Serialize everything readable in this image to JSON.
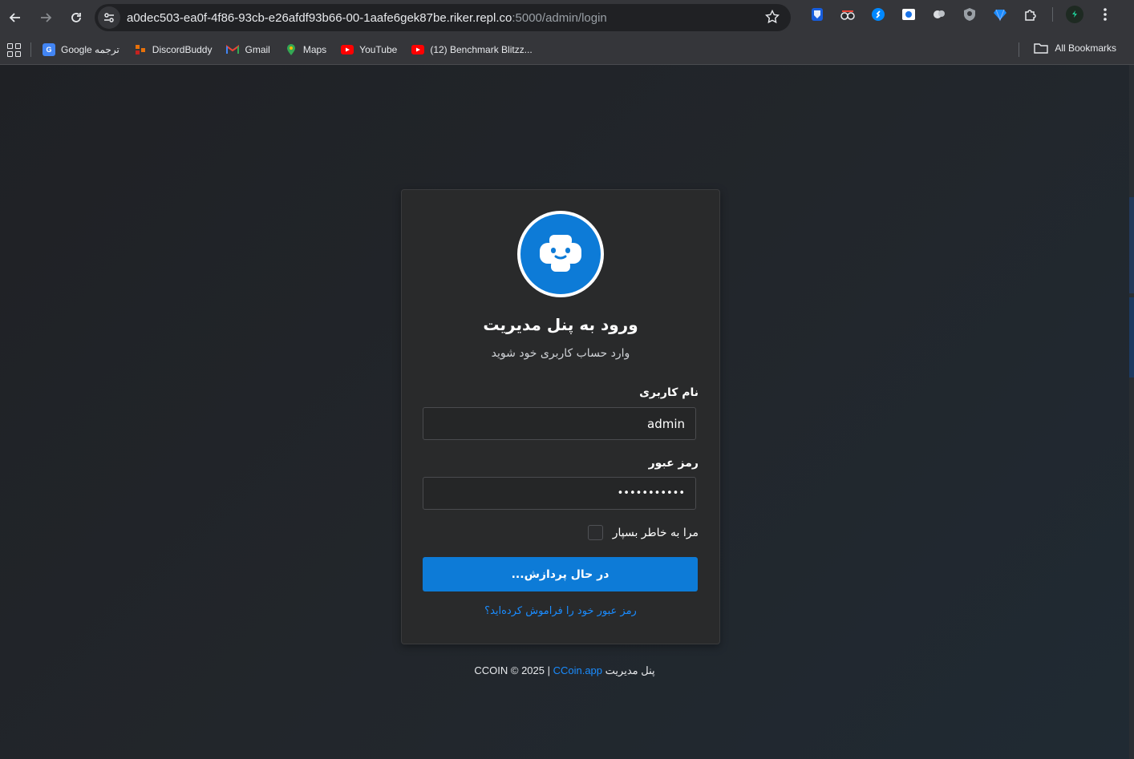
{
  "browser": {
    "url_host": "a0dec503-ea0f-4f86-93cb-e26afdf93b66-00-1aafe6gek87be.riker.repl.co",
    "url_path": ":5000/admin/login",
    "icons": {
      "back": "arrow-left-icon",
      "forward": "arrow-right-icon",
      "reload": "reload-icon",
      "site_settings": "tune-icon",
      "bookmark_star": "star-icon",
      "extensions": "puzzle-icon",
      "menu": "kebab-menu-icon"
    },
    "bookmarks": [
      {
        "label": "Google ترجمه",
        "icon": "google-translate-icon",
        "color": "#4285f4"
      },
      {
        "label": "DiscordBuddy",
        "icon": "discordbuddy-icon",
        "color": "#e8710a"
      },
      {
        "label": "Gmail",
        "icon": "gmail-icon",
        "color": "#ea4335"
      },
      {
        "label": "Maps",
        "icon": "maps-pin-icon",
        "color": "#34a853"
      },
      {
        "label": "YouTube",
        "icon": "youtube-icon",
        "color": "#ff0000"
      },
      {
        "label": "(12) Benchmark Blitzz...",
        "icon": "youtube-icon",
        "color": "#ff0000"
      }
    ],
    "all_bookmarks_label": "All Bookmarks"
  },
  "login": {
    "title": "ورود به پنل مدیریت",
    "subtitle": "وارد حساب کاربری خود شوید",
    "username_label": "نام کاربری",
    "username_value": "admin",
    "password_label": "رمز عبور",
    "password_value": "•••••••••••",
    "remember_label": "مرا به خاطر بسپار",
    "remember_checked": false,
    "submit_label": "در حال پردازش...",
    "forgot_link": "رمز عبور خود را فراموش کرده‌اید؟",
    "accent_color": "#0d7bd7"
  },
  "footer": {
    "prefix": "CCOIN © 2025 | ",
    "link": "CCoin.app",
    "suffix": " پنل مدیریت"
  }
}
